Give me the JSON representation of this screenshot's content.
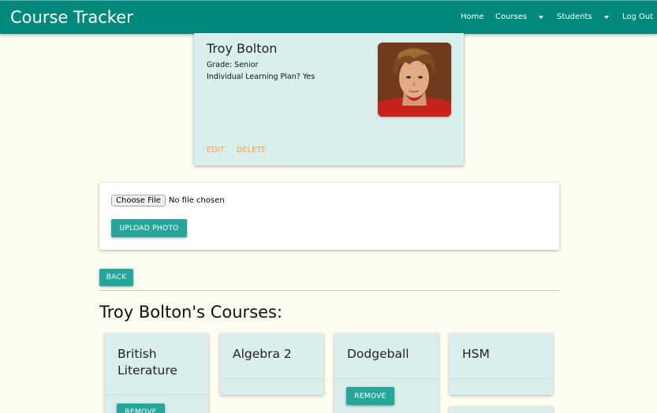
{
  "navbar": {
    "brand": "Course Tracker",
    "items": [
      {
        "label": "Home"
      },
      {
        "label": "Courses"
      },
      {
        "label": "Students"
      },
      {
        "label": "Log Out"
      }
    ]
  },
  "student": {
    "name": "Troy Bolton",
    "grade": "Grade: Senior",
    "ilp": "Individual Learning Plan? Yes",
    "photo_icon": "student-photo",
    "actions": {
      "edit": "EDIT",
      "delete": "DELETE"
    }
  },
  "upload": {
    "choose_file": "Choose File",
    "file_status": "No file chosen",
    "upload_button": "UPLOAD PHOTO"
  },
  "back_button": "BACK",
  "courses_heading": "Troy Bolton's Courses:",
  "courses": [
    {
      "title_line1": "British",
      "title_line2": "Literature",
      "button": "REMOVE"
    },
    {
      "title": "Algebra 2"
    },
    {
      "title": "Dodgeball",
      "button": "REMOVE"
    },
    {
      "title": "HSM"
    }
  ],
  "colors": {
    "navbar": "#00897b",
    "button": "#26a69a",
    "card": "#d9eeed",
    "action_link": "#f5a33c",
    "background": "#fdfdf1"
  }
}
